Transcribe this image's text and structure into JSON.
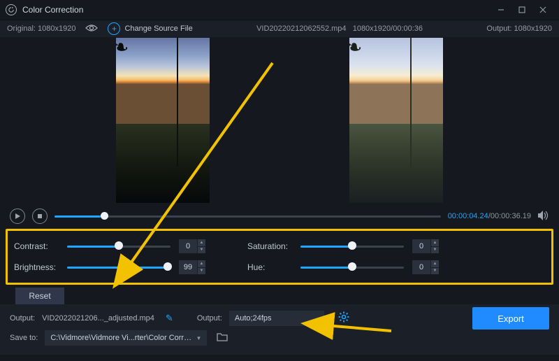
{
  "window": {
    "title": "Color Correction"
  },
  "header": {
    "original_label": "Original:",
    "original_res": "1080x1920",
    "change_source": "Change Source File",
    "file_name": "VID20220212062552.mp4",
    "file_res": "1080x1920",
    "file_dur": "00:00:36",
    "output_label": "Output:",
    "output_res": "1080x1920"
  },
  "timeline": {
    "current": "00:00:04.24",
    "total": "00:00:36.19",
    "progress_pct": 12
  },
  "adjust": {
    "contrast": {
      "label": "Contrast:",
      "value": 0,
      "pct": 50
    },
    "brightness": {
      "label": "Brightness:",
      "value": 99,
      "pct": 100
    },
    "saturation": {
      "label": "Saturation:",
      "value": 0,
      "pct": 50
    },
    "hue": {
      "label": "Hue:",
      "value": 0,
      "pct": 50
    },
    "reset": "Reset"
  },
  "bottom": {
    "output_file_label": "Output:",
    "output_file": "VID2022021206..._adjusted.mp4",
    "output_fmt_label": "Output:",
    "output_fmt": "Auto;24fps",
    "save_label": "Save to:",
    "save_path": "C:\\Vidmore\\Vidmore Vi...rter\\Color Correction",
    "export": "Export"
  }
}
